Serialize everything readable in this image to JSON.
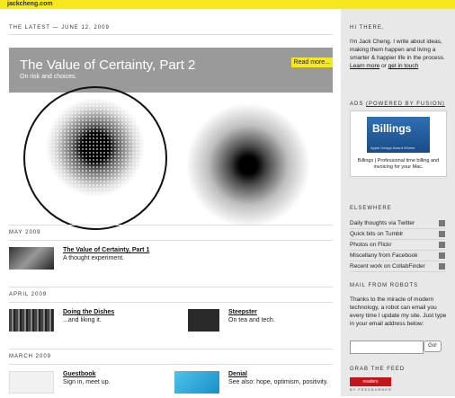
{
  "site": "jackcheng.com",
  "latest": {
    "label": "THE LATEST — JUNE 12, 2009",
    "title": "The Value of Certainty, Part 2",
    "subtitle": "On risk and choices.",
    "read_more": "Read more..."
  },
  "sections": [
    {
      "label": "MAY 2009",
      "items": [
        {
          "title": "The Value of Certainty, Part 1",
          "desc": "A thought experiment."
        }
      ]
    },
    {
      "label": "APRIL 2009",
      "items": [
        {
          "title": "Doing the Dishes",
          "desc": "...and liking it."
        },
        {
          "title": "Steepster",
          "desc": "On tea and tech."
        }
      ]
    },
    {
      "label": "MARCH 2009",
      "items": [
        {
          "title": "Guestbook",
          "desc": "Sign in, meet up."
        },
        {
          "title": "Denial",
          "desc": "See also: hope, optimism, positivity."
        }
      ]
    }
  ],
  "sidebar": {
    "hi_label": "HI THERE,",
    "intro": "I'm Jack Cheng. I write about ideas, making them happen and living a smarter & happier life in the process.",
    "learn_more": "Learn more",
    "or": "or",
    "get_in_touch": "get in touch",
    "ads_label": "ADS",
    "ads_powered": "(POWERED BY FUSION)",
    "ad_name": "Billings",
    "ad_award": "Apple Design Award Winner",
    "ad_caption": "Billings | Professional time billing and invoicing for your Mac.",
    "elsewhere_label": "ELSEWHERE",
    "elsewhere": [
      {
        "text": "Daily thoughts via Twitter",
        "icon": "twitter-icon"
      },
      {
        "text": "Quick bits on Tumblr",
        "icon": "tumblr-icon"
      },
      {
        "text": "Photos on Flickr",
        "icon": "flickr-icon"
      },
      {
        "text": "Miscellany from Facebook",
        "icon": "facebook-icon"
      },
      {
        "text": "Recent work on CollabFinder",
        "icon": "collabfinder-icon"
      }
    ],
    "mail_label": "MAIL FROM ROBOTS",
    "mail_text": "Thanks to the miracle of modern technology, a robot can email you every time I update my site. Just type in your email address below:",
    "go": "Go!",
    "feed_label": "GRAB THE FEED",
    "feed_badge": "readers",
    "feed_by": "BY FEEDBURNER"
  }
}
